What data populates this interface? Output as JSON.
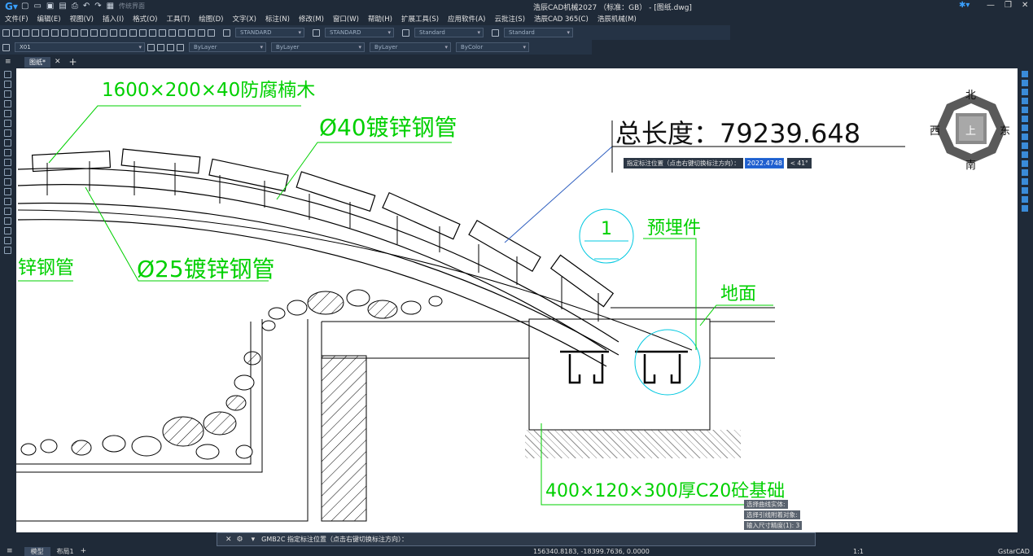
{
  "app": {
    "title": "浩辰CAD机械2027 （标准：GB） - [图纸.dwg]",
    "workspace": "传统界面"
  },
  "menu": [
    "文件(F)",
    "编辑(E)",
    "视图(V)",
    "插入(I)",
    "格式(O)",
    "工具(T)",
    "绘图(D)",
    "文字(X)",
    "标注(N)",
    "修改(M)",
    "窗口(W)",
    "帮助(H)",
    "扩展工具(S)",
    "应用软件(A)",
    "云批注(S)",
    "浩辰CAD 365(C)",
    "浩辰机械(M)"
  ],
  "toolbar": {
    "text_style": "STANDARD",
    "dim_style": "STANDARD",
    "table_style": "Standard",
    "mleader_style": "Standard",
    "layer": "X01",
    "color": "ByLayer",
    "linetype": "ByLayer",
    "lineweight": "ByLayer",
    "plotstyle": "ByColor"
  },
  "tabs": {
    "drawing": "图纸*"
  },
  "drawing": {
    "label_wood": "1600×200×40防腐楠木",
    "label_pipe40": "Ø40镀锌钢管",
    "label_pipe25": "Ø25镀锌钢管",
    "label_pipe_left": "锌钢管",
    "label_embed": "预埋件",
    "label_embed_num": "1",
    "label_ground": "地面",
    "label_base": "400×120×300厚C20砼基础",
    "total_length": "总长度：79239.648"
  },
  "compass": {
    "n": "北",
    "s": "南",
    "e": "东",
    "w": "西",
    "up": "上"
  },
  "dim_input": {
    "prompt": "指定标注位置（点击右键切换标注方向）：",
    "value": "2022.4748",
    "angle": "< 41°"
  },
  "cmd_history": [
    "选择曲线实体:",
    "选择引线附着对象:",
    "输入尺寸精度(1): 3"
  ],
  "command": {
    "text": "GMB2C 指定标注位置（点击右键切换标注方向）："
  },
  "status": {
    "tab_model": "模型",
    "tab_layout": "布局1",
    "coords": "156340.8183, -18399.7636, 0.0000",
    "brand": "GstarCAD",
    "scale": "1:1"
  },
  "colors": {
    "annotation": "#00d000",
    "bg_canvas": "#ffffff",
    "ui_dark": "#1f2a38",
    "accent": "#1f5fcf"
  }
}
